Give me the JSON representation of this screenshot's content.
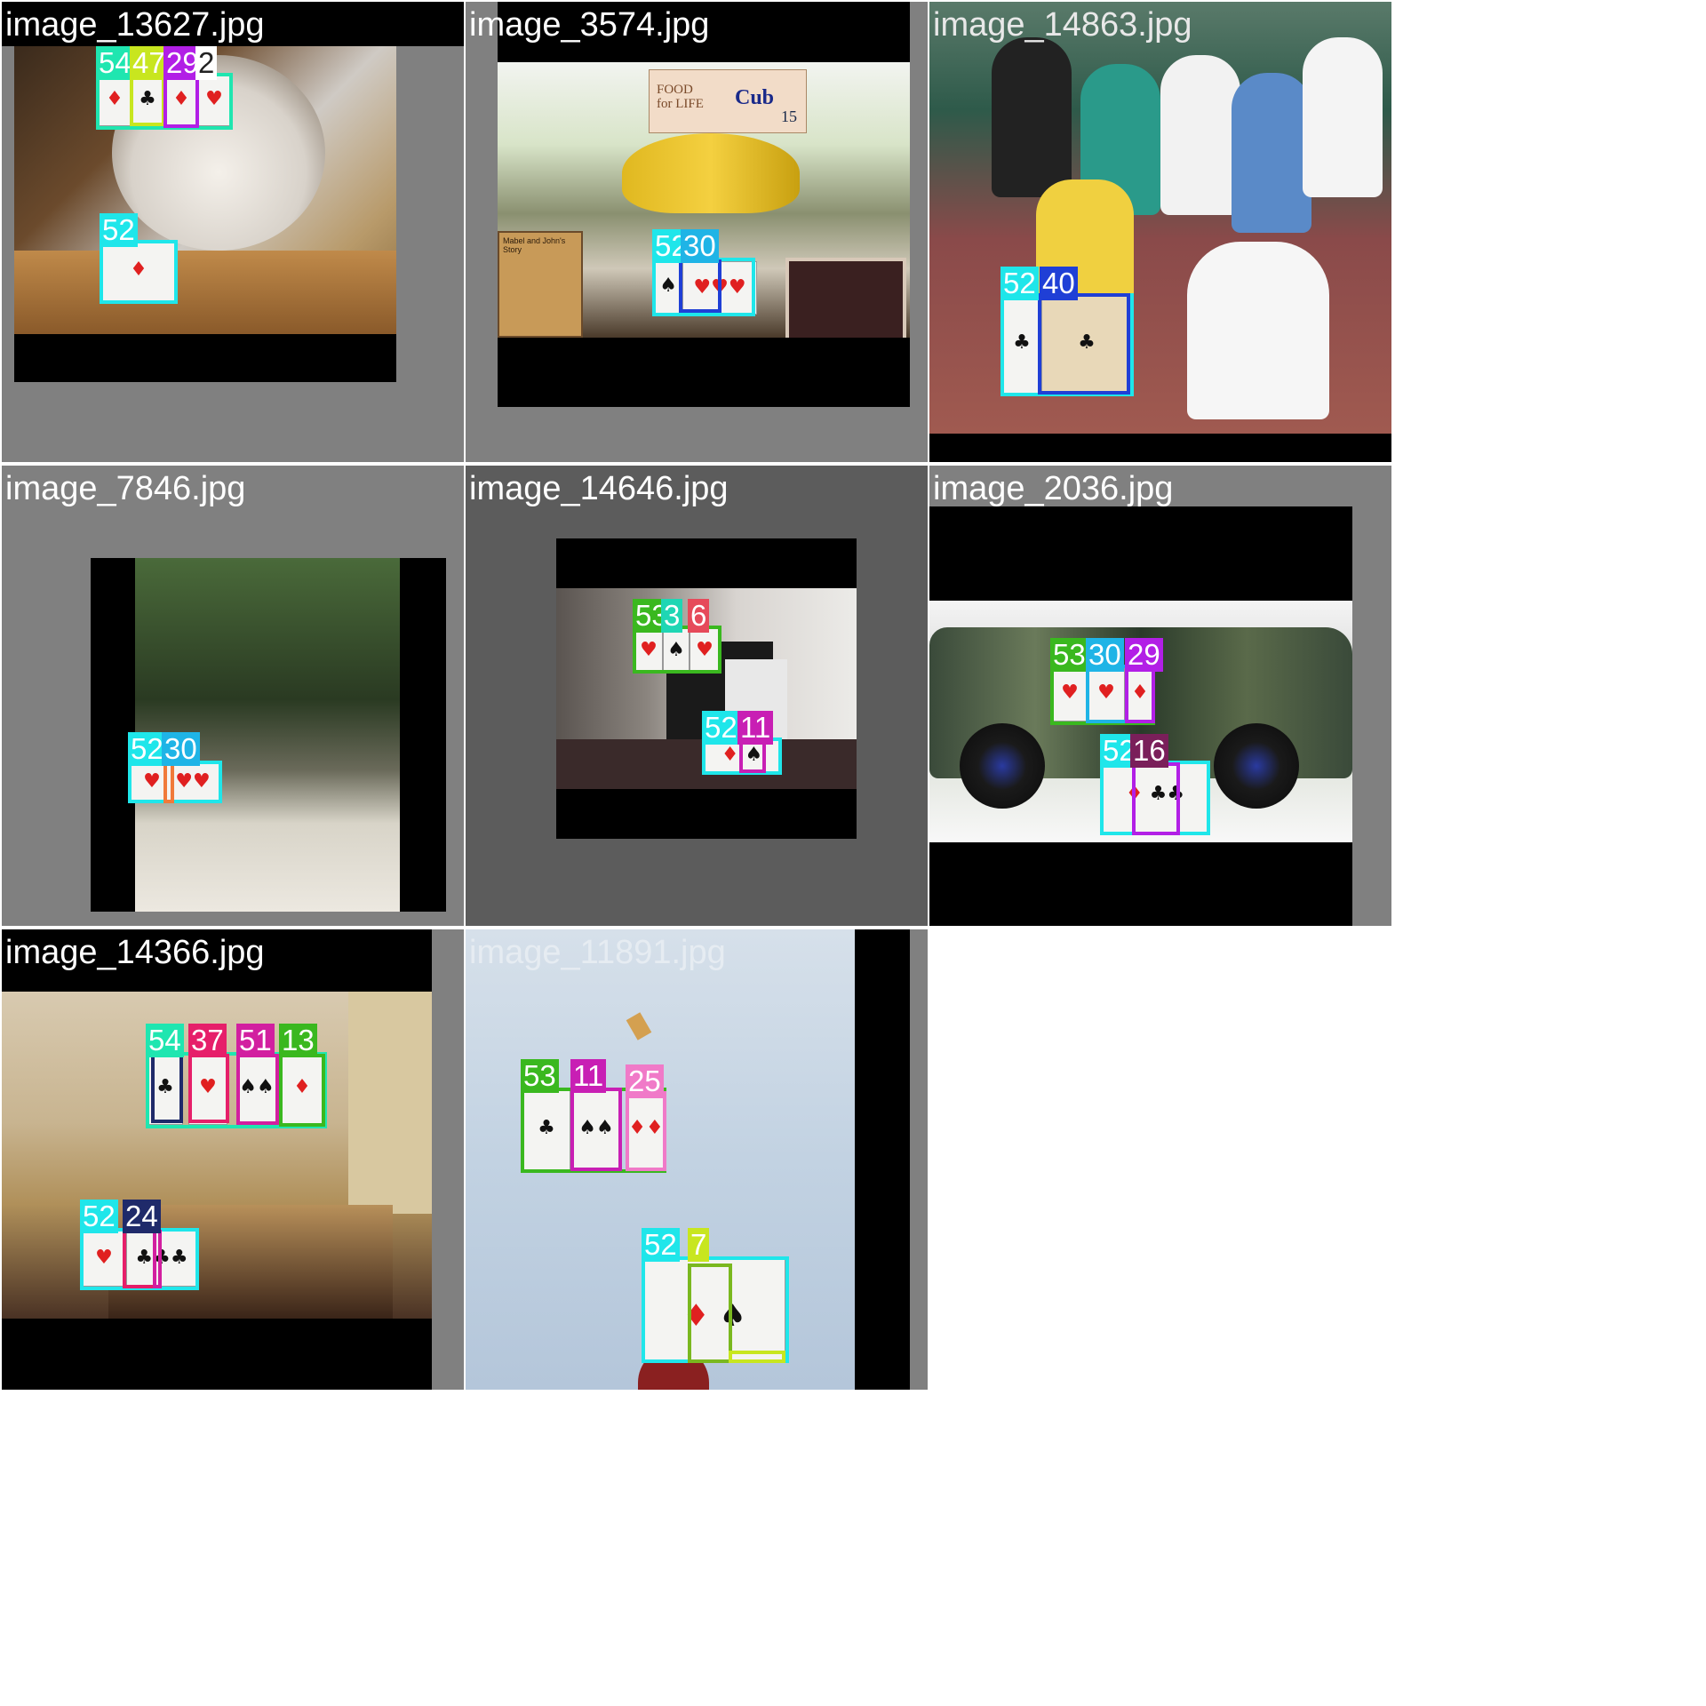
{
  "tiles": [
    {
      "filename": "image_13627.jpg",
      "labels": [
        "54",
        "47",
        "29",
        "2",
        "52"
      ]
    },
    {
      "filename": "image_3574.jpg",
      "labels": [
        "52",
        "30"
      ],
      "sign": {
        "brand1": "FOOD for LIFE",
        "brand2": "Cub",
        "number": "15"
      },
      "plaque_title": "Mabel and John's Story"
    },
    {
      "filename": "image_14863.jpg",
      "labels": [
        "52",
        "40"
      ]
    },
    {
      "filename": "image_7846.jpg",
      "labels": [
        "52",
        "30"
      ]
    },
    {
      "filename": "image_14646.jpg",
      "labels": [
        "53",
        "3",
        "6",
        "52",
        "11"
      ]
    },
    {
      "filename": "image_2036.jpg",
      "labels": [
        "53",
        "30",
        "29",
        "52",
        "16"
      ]
    },
    {
      "filename": "image_14366.jpg",
      "labels": [
        "54",
        "37",
        "51",
        "13",
        "52",
        "24"
      ]
    },
    {
      "filename": "image_11891.jpg",
      "labels": [
        "53",
        "11",
        "25",
        "52",
        "7"
      ]
    }
  ],
  "colors": {
    "c52": "#1fe6ea",
    "c54": "#1fe6b0",
    "c47": "#c8e61f",
    "c29": "#b21fe6",
    "c2": "#ffffff",
    "c30": "#1fb4e6",
    "c40": "#1f3fd6",
    "c53": "#3ab81f",
    "c3": "#1fd6b4",
    "c6": "#e64a5a",
    "c11": "#c81fb4",
    "c16": "#7a1f5a",
    "c37": "#e61f6a",
    "c51": "#d21fa0",
    "c13": "#3ab81f",
    "c24": "#1f2a6a",
    "c25": "#f07ac8",
    "c7": "#c8e61f"
  }
}
